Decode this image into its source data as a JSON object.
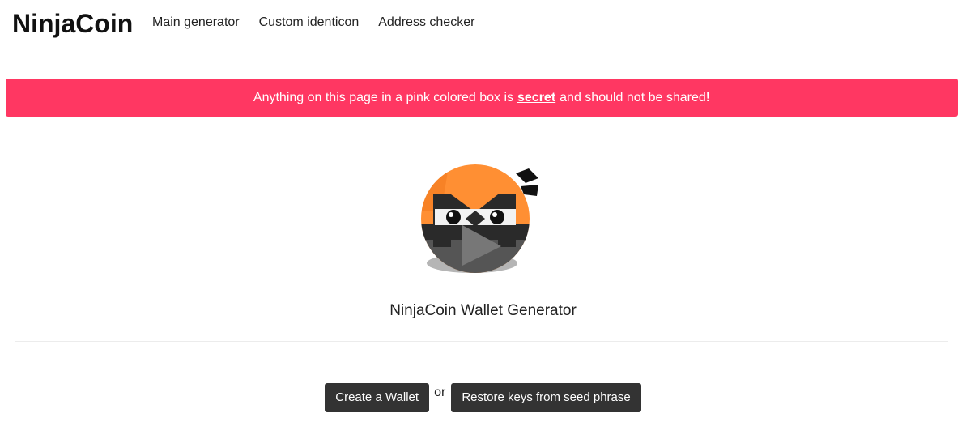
{
  "header": {
    "brand": "NinjaCoin",
    "nav": [
      {
        "label": "Main generator"
      },
      {
        "label": "Custom identicon"
      },
      {
        "label": "Address checker"
      }
    ]
  },
  "alert": {
    "prefix": "Anything on this page in a pink colored box is",
    "emphasis": "secret",
    "suffix": "and should not be shared",
    "end": "!"
  },
  "hero": {
    "logo_icon": "ninjacoin-logo-icon",
    "subtitle": "NinjaCoin Wallet Generator"
  },
  "actions": {
    "create_label": "Create a Wallet",
    "or_label": "or",
    "restore_label": "Restore keys from seed phrase"
  },
  "colors": {
    "alert_bg": "#ff3762",
    "button_bg": "#333333",
    "logo_orange": "#ff8f33"
  }
}
